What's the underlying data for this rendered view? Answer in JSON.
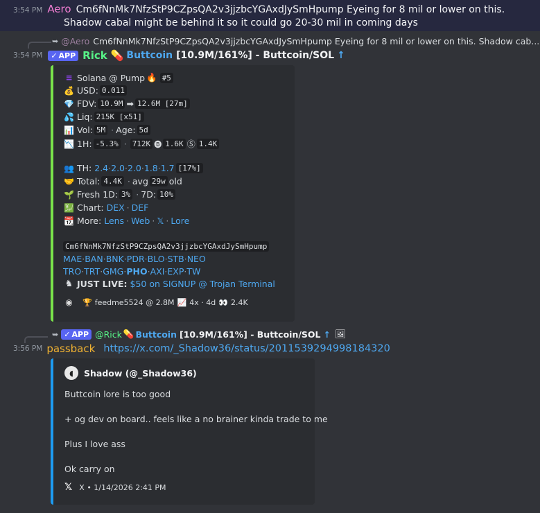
{
  "msg1": {
    "time": "3:54 PM",
    "author": "Aero",
    "line1": "Cm6fNnMk7NfzStP9CZpsQA2v3jjzbcYGAxdJySmHpump Eyeing for 8 mil or lower on this.",
    "line2": "Shadow cabal might be behind it so it could go 20-30 mil in coming days"
  },
  "msg2": {
    "reply_author": "@Aero",
    "reply_text": "Cm6fNnMk7NfzStP9CZpsQA2v3jjzbcYGAxdJySmHpump Eyeing for 8 mil or lower on this. Shadow cab...",
    "time": "3:54 PM",
    "app_label": "APP",
    "author": "Rick",
    "title_link": "Buttcoin",
    "title_rest": "[10.9M/161%] - Buttcoin/SOL",
    "embed": {
      "chain": "Solana @ Pump",
      "rank": "#5",
      "usd_label": "USD:",
      "usd": "0.011",
      "fdv_label": "FDV:",
      "fdv_from": "10.9M",
      "fdv_to": "12.6M [27m]",
      "liq_label": "Liq:",
      "liq": "215K [x51]",
      "vol_label": "Vol:",
      "vol": "5M",
      "age_label": "Age:",
      "age": "5d",
      "h1_label": "1H:",
      "h1_change": "-5.3%",
      "h1_vol": "712K",
      "h1_buys": "1.6K",
      "h1_sells": "1.4K",
      "th_label": "TH:",
      "th_values": [
        "2.4",
        "2.0",
        "2.0",
        "1.8",
        "1.7"
      ],
      "th_pct": "[17%]",
      "total_label": "Total:",
      "total": "4.4K",
      "avg_label": "avg",
      "avg": "29w",
      "old_label": "old",
      "fresh_label": "Fresh 1D:",
      "fresh1d": "3%",
      "fresh7d_label": "7D:",
      "fresh7d": "10%",
      "chart_label": "Chart:",
      "chart_links": [
        "DEX",
        "DEF"
      ],
      "more_label": "More:",
      "more_links": [
        "Lens",
        "Web",
        "𝕏",
        "Lore"
      ],
      "address": "Cm6fNnMk7NfzStP9CZpsQA2v3jjzbcYGAxdJySmHpump",
      "bots_row1": [
        "MAE",
        "BAN",
        "BNK",
        "PDR",
        "BLO",
        "STB",
        "NEO"
      ],
      "bots_row2": [
        "TRO",
        "TRT",
        "GMG",
        "PHO",
        "AXI",
        "EXP",
        "TW"
      ],
      "just_live_label": "JUST LIVE:",
      "just_live_link": "$50 on SIGNUP @ Trojan Terminal",
      "footer_user": "feedme5524 @ 2.8M",
      "footer_stats": "4x · 4d",
      "footer_views": "2.4K"
    }
  },
  "msg3": {
    "reply_app": "APP",
    "reply_author": "@Rick",
    "reply_link": "Buttcoin",
    "reply_rest": "[10.9M/161%] - Buttcoin/SOL",
    "time": "3:56 PM",
    "author": "passback",
    "url": "https://x.com/_Shadow36/status/2011539294998184320",
    "tweet": {
      "author": "Shadow (@_Shadow36)",
      "p1": "Buttcoin lore is too good",
      "p2": "+ og dev on board.. feels like a no brainer kinda trade to me",
      "p3": "Plus I love ass",
      "p4": "Ok carry on",
      "footer": "X • 1/14/2026 2:41 PM"
    }
  },
  "colors": {
    "bg": "#313338",
    "highlight": "#26283f",
    "embed_accent_green": "#79e24a",
    "embed_accent_blue": "#1d9bf0",
    "link": "#4ea8f0",
    "app_badge": "#5865f2"
  }
}
